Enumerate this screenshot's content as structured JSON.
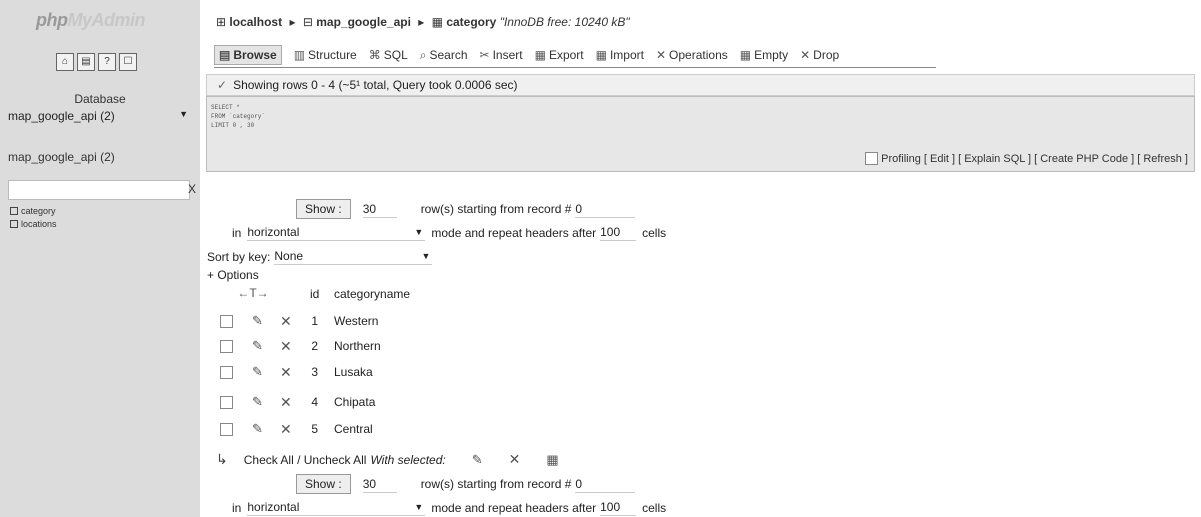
{
  "sidebar": {
    "logo_php": "php",
    "logo_my": "MyAdmin",
    "icons": [
      "home-icon",
      "query-window-icon",
      "docs-icon",
      "settings-icon"
    ],
    "database_label": "Database",
    "database_selected": "map_google_api (2)",
    "db_title": "map_google_api (2)",
    "filter_clear": "X",
    "tables": [
      "category",
      "locations"
    ]
  },
  "breadcrumb": {
    "server": "localhost",
    "database": "map_google_api",
    "table": "category",
    "info": "\"InnoDB free: 10240 kB\""
  },
  "tabs": [
    {
      "label": "Browse",
      "icon": "browse-icon"
    },
    {
      "label": "Structure",
      "icon": "structure-icon"
    },
    {
      "label": "SQL",
      "icon": "sql-icon"
    },
    {
      "label": "Search",
      "icon": "search-icon"
    },
    {
      "label": "Insert",
      "icon": "insert-icon"
    },
    {
      "label": "Export",
      "icon": "export-icon"
    },
    {
      "label": "Import",
      "icon": "import-icon"
    },
    {
      "label": "Operations",
      "icon": "operations-icon"
    },
    {
      "label": "Empty",
      "icon": "empty-icon"
    },
    {
      "label": "Drop",
      "icon": "drop-icon"
    }
  ],
  "message": "Showing rows 0 - 4 (~5¹ total, Query took 0.0006 sec)",
  "sql": {
    "query": "SELECT *\nFROM `category`\nLIMIT 0 , 30",
    "profiling": "Profiling",
    "links": "[ Edit ] [ Explain SQL ] [ Create PHP Code ] [ Refresh ]"
  },
  "nav": {
    "show_label": "Show :",
    "rows_value": "30",
    "rows_text": "row(s) starting from record #",
    "start_value": "0",
    "in_label": "in",
    "mode_value": "horizontal",
    "mode_text": "mode and repeat headers after",
    "repeat_value": "100",
    "cells_text": "cells"
  },
  "sort": {
    "label": "Sort by key:",
    "value": "None"
  },
  "options_label": "+ Options",
  "table": {
    "arrows": "←T→",
    "columns": [
      "id",
      "categoryname"
    ],
    "rows": [
      {
        "id": "1",
        "name": "Western"
      },
      {
        "id": "2",
        "name": "Northern"
      },
      {
        "id": "3",
        "name": "Lusaka"
      },
      {
        "id": "4",
        "name": "Chipata"
      },
      {
        "id": "5",
        "name": "Central"
      }
    ]
  },
  "bulk": {
    "check_all": "Check All / Uncheck All",
    "with_selected": "With selected:"
  }
}
